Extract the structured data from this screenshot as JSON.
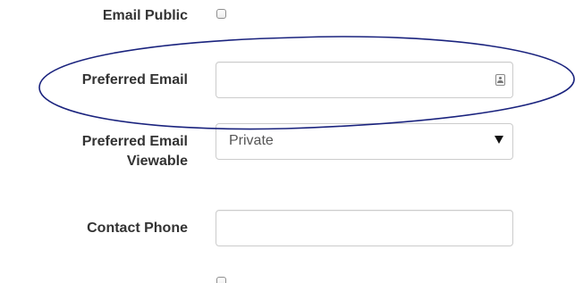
{
  "fields": {
    "email_public": {
      "label": "Email Public",
      "checked": false
    },
    "preferred_email": {
      "label": "Preferred Email",
      "value": ""
    },
    "preferred_email_viewable": {
      "label": "Preferred Email Viewable",
      "selected": "Private"
    },
    "contact_phone": {
      "label": "Contact Phone",
      "value": ""
    },
    "next_checkbox": {
      "checked": false
    }
  },
  "annotation": {
    "shape": "ellipse",
    "color": "#1a237e"
  }
}
